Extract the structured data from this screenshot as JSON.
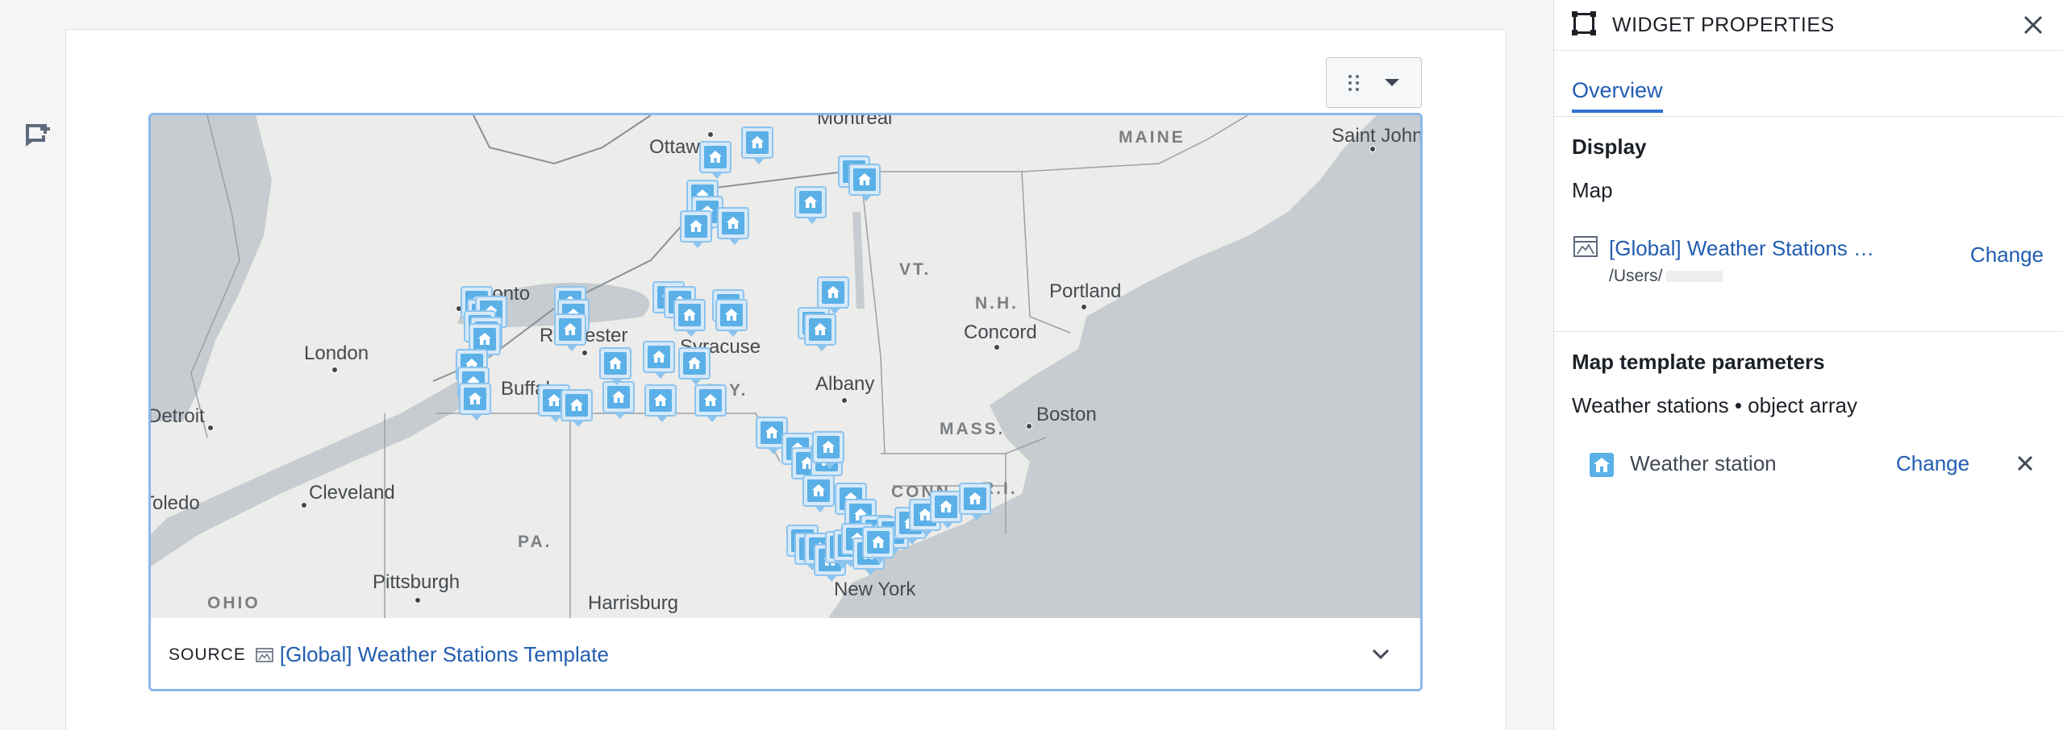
{
  "gutter": {
    "icon": "add-comment-icon"
  },
  "widget": {
    "handle": {
      "grip_icon": "drag-handle-icon",
      "menu_icon": "caret-down-icon"
    },
    "map": {
      "cities": {
        "ottawa": "Ottawa",
        "montreal": "Montreal",
        "toronto": "Toronto",
        "london": "London",
        "detroit": "Detroit",
        "toledo": "Toledo",
        "cleveland": "Cleveland",
        "pittsburgh": "Pittsburgh",
        "harrisburg": "Harrisburg",
        "new_york": "New York",
        "rochester": "Rochester",
        "syracuse": "Syracuse",
        "buffalo": "Buffalo",
        "albany": "Albany",
        "boston": "Boston",
        "portland": "Portland",
        "concord": "Concord",
        "saint_john": "Saint John"
      },
      "regions": {
        "maine": "MAINE",
        "vt": "VT.",
        "nh": "N.H.",
        "ny": "N.Y.",
        "mass": "MASS.",
        "conn": "CONN.",
        "ri": "R.I.",
        "pa": "PA.",
        "ohio": "OHIO"
      },
      "marker_icon": "house-icon",
      "marker_count": 60
    },
    "source": {
      "label": "SOURCE",
      "icon": "map-template-icon",
      "name": "[Global] Weather Stations Template",
      "expand_icon": "chevron-down-icon"
    }
  },
  "panel": {
    "header": {
      "icon": "widget-frame-icon",
      "title": "WIDGET PROPERTIES",
      "close_icon": "close-icon"
    },
    "tabs": [
      {
        "label": "Overview"
      }
    ],
    "display": {
      "title": "Display",
      "type": "Map",
      "template_icon": "map-template-icon",
      "template_name": "[Global] Weather Stations …",
      "template_path": "/Users/",
      "change_label": "Change"
    },
    "params": {
      "title": "Map template parameters",
      "subtitle": "Weather stations • object array",
      "item_icon": "house-icon",
      "item_label": "Weather station",
      "change_label": "Change",
      "remove_icon": "close-icon"
    }
  },
  "colors": {
    "accent": "#215db0",
    "widget_border": "#8ab8ec",
    "marker_fill": "#5ab0e7",
    "water": "#c6cccf",
    "land": "#ececea"
  }
}
